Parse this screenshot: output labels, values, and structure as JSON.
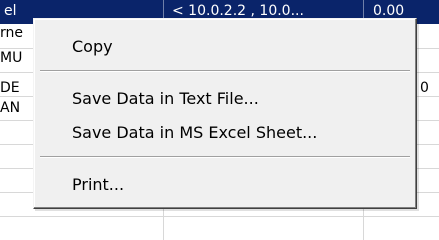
{
  "header": {
    "col_a": "el",
    "col_b": "< 10.0.2.2 , 10.0...",
    "col_c": "0.00"
  },
  "rows": [
    {
      "label": "rne",
      "value": ""
    },
    {
      "label": "MU",
      "value": ""
    },
    {
      "label": "DE",
      "value": "0"
    },
    {
      "label": "AN",
      "value": ""
    }
  ],
  "context_menu": {
    "copy": "Copy",
    "save_text": "Save Data in Text File...",
    "save_excel": "Save Data in MS Excel Sheet...",
    "print": "Print..."
  }
}
